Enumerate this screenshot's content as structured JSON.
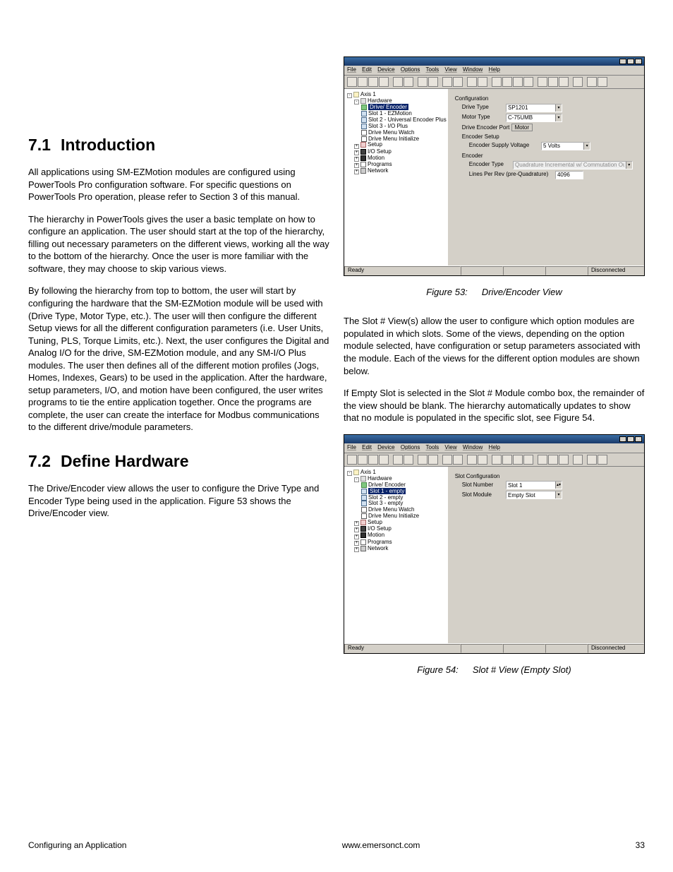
{
  "sections": {
    "s71_num": "7.1",
    "s71_title": "Introduction",
    "s72_num": "7.2",
    "s72_title": "Define Hardware"
  },
  "paragraphs": {
    "p1": "All applications using SM-EZMotion modules are configured using PowerTools Pro configuration software. For specific questions on PowerTools Pro operation, please refer to Section 3 of this manual.",
    "p2": "The hierarchy in PowerTools gives the user a basic template on how to configure an application. The user should start at the top of the hierarchy, filling out necessary parameters on the different views, working all the way to the bottom of the hierarchy. Once the user is more familiar with the software, they may choose to skip various views.",
    "p3": "By following the hierarchy from top to bottom, the user will start by configuring the hardware that the SM-EZMotion module will be used with (Drive Type, Motor Type, etc.). The user will then configure the different Setup views for all the different configuration parameters (i.e. User Units, Tuning, PLS, Torque Limits, etc.). Next, the user configures the Digital and Analog I/O for the drive, SM-EZMotion module, and any SM-I/O Plus modules. The user then defines all of the different motion profiles (Jogs, Homes, Indexes, Gears) to be used in the application. After the hardware, setup parameters, I/O, and motion have been configured, the user writes programs to tie the entire application together. Once the programs are complete, the user can create the interface for Modbus communications to the different drive/module parameters.",
    "p4": "The Drive/Encoder view allows the user to configure the Drive Type and Encoder Type being used in the application. Figure 53 shows the Drive/Encoder view.",
    "p5": "The Slot # View(s) allow the user to configure which option modules are populated in which slots. Some of the views, depending on the option module selected, have configuration or setup parameters associated with the module. Each of the views for the different option modules are shown below.",
    "p6": "If Empty Slot is selected in the Slot # Module combo box, the remainder of the view should be blank. The hierarchy automatically updates to show that no module is populated in the specific slot, see Figure 54."
  },
  "app": {
    "menu": {
      "file": "File",
      "edit": "Edit",
      "device": "Device",
      "options": "Options",
      "tools": "Tools",
      "view": "View",
      "window": "Window",
      "help": "Help"
    },
    "status": {
      "ready": "Ready",
      "state": "Disconnected"
    }
  },
  "fig53": {
    "caption_num": "Figure 53:",
    "caption_text": "Drive/Encoder View",
    "tree": {
      "axis": "Axis 1",
      "hardware": "Hardware",
      "drive_encoder": "Drive/ Encoder",
      "slot1": "Slot 1 - EZMotion",
      "slot2": "Slot 2 - Universal Encoder Plus",
      "slot3": "Slot 3 - I/O Plus",
      "dmw": "Drive Menu Watch",
      "dmi": "Drive Menu Initialize",
      "setup": "Setup",
      "io": "I/O Setup",
      "motion": "Motion",
      "programs": "Programs",
      "network": "Network"
    },
    "form": {
      "config_label": "Configuration",
      "drive_type_label": "Drive Type",
      "drive_type_value": "SP1201",
      "motor_type_label": "Motor Type",
      "motor_type_value": "C-75UMB",
      "drive_encoder_port_label": "Drive Encoder Port",
      "motor_tab": "Motor",
      "encoder_setup_label": "Encoder Setup",
      "encoder_supply_label": "Encoder Supply Voltage",
      "encoder_supply_value": "5 Volts",
      "encoder_label": "Encoder",
      "encoder_type_label": "Encoder Type",
      "encoder_type_value": "Quadrature Incremental w/ Commutation Outputs",
      "lines_label": "Lines Per Rev (pre-Quadrature)",
      "lines_value": "4096"
    }
  },
  "fig54": {
    "caption_num": "Figure 54:",
    "caption_text": "Slot # View (Empty Slot)",
    "tree": {
      "axis": "Axis 1",
      "hardware": "Hardware",
      "drive_encoder": "Drive/ Encoder",
      "slot1": "Slot 1 - empty",
      "slot2": "Slot 2 - empty",
      "slot3": "Slot 3 - empty",
      "dmw": "Drive Menu Watch",
      "dmi": "Drive Menu Initialize",
      "setup": "Setup",
      "io": "I/O Setup",
      "motion": "Motion",
      "programs": "Programs",
      "network": "Network"
    },
    "form": {
      "slot_config_label": "Slot Configuration",
      "slot_number_label": "Slot Number",
      "slot_number_value": "Slot 1",
      "slot_module_label": "Slot Module",
      "slot_module_value": "Empty Slot"
    }
  },
  "footer": {
    "left": "Configuring an Application",
    "center": "www.emersonct.com",
    "right": "33"
  }
}
